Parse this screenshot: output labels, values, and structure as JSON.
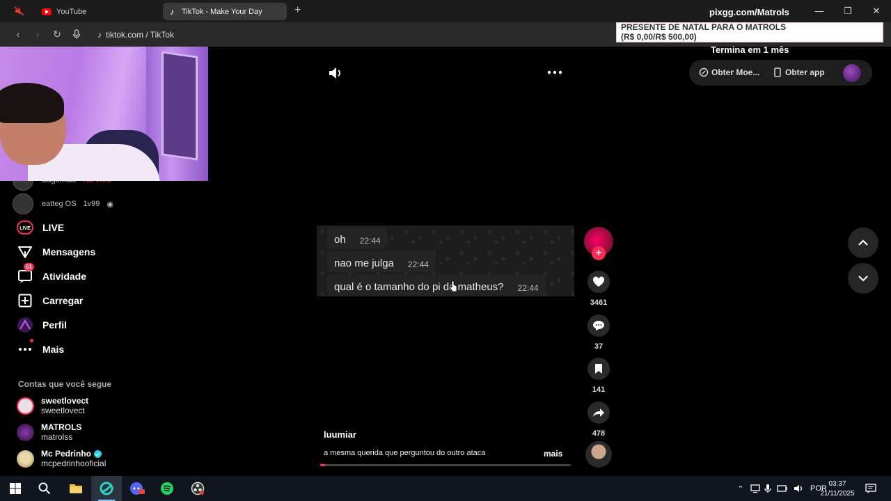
{
  "browser": {
    "tabs": [
      {
        "label": "YouTube",
        "active": false
      },
      {
        "label": "TikTok - Make Your Day",
        "active": true
      }
    ],
    "url": "tiktok.com / TikTok",
    "overlay_title": "pixgg.com/Matrols",
    "donation_line1": "PRESENTE DE NATAL PARA O MATROLS",
    "donation_line2": "(R$ 0,00/R$ 500,00)",
    "donation_progress": 0.0,
    "termina": "Termina em 1 mês"
  },
  "sidebar": {
    "live_rows": [
      {
        "name": "Sugomido",
        "badge": "AO VIVO"
      },
      {
        "name": "eatteg OS",
        "extra": "1v99"
      }
    ],
    "nav": [
      {
        "label": "LIVE",
        "icon": "live-icon"
      },
      {
        "label": "Mensagens",
        "icon": "messages-icon"
      },
      {
        "label": "Atividade",
        "icon": "activity-icon",
        "badge": "51"
      },
      {
        "label": "Carregar",
        "icon": "upload-icon"
      },
      {
        "label": "Perfil",
        "icon": "profile-icon"
      },
      {
        "label": "Mais",
        "icon": "more-icon"
      }
    ],
    "following_title": "Contas que você segue",
    "following": [
      {
        "name": "sweetlovect",
        "handle": "sweetlovect",
        "color": "#e8e0e8"
      },
      {
        "name": "MATROLS",
        "handle": "matrolss",
        "color": "#5a2a7a"
      },
      {
        "name": "Mc Pedrinho",
        "handle": "mcpedrinhooficial",
        "verified": true,
        "color": "#e9d9a8"
      }
    ]
  },
  "top_actions": {
    "coins": "Obter Moe...",
    "app": "Obter app"
  },
  "video": {
    "messages": [
      {
        "text": "oh",
        "time": "22:44"
      },
      {
        "text": "nao me julga",
        "time": "22:44"
      },
      {
        "text": "qual é o tamanho do pi do matheus?",
        "time": "22:44"
      }
    ],
    "author": "luumiar",
    "caption": "a mesma querida que perguntou do outro ataca",
    "more_label": "mais",
    "progress": 0.02
  },
  "stats": {
    "likes": "3461",
    "comments": "37",
    "saves": "141",
    "shares": "478"
  },
  "taskbar": {
    "language": "POR",
    "time": "03:37",
    "date": "21/11/2025"
  },
  "colors": {
    "accent": "#fe2c55",
    "background": "#000000"
  }
}
